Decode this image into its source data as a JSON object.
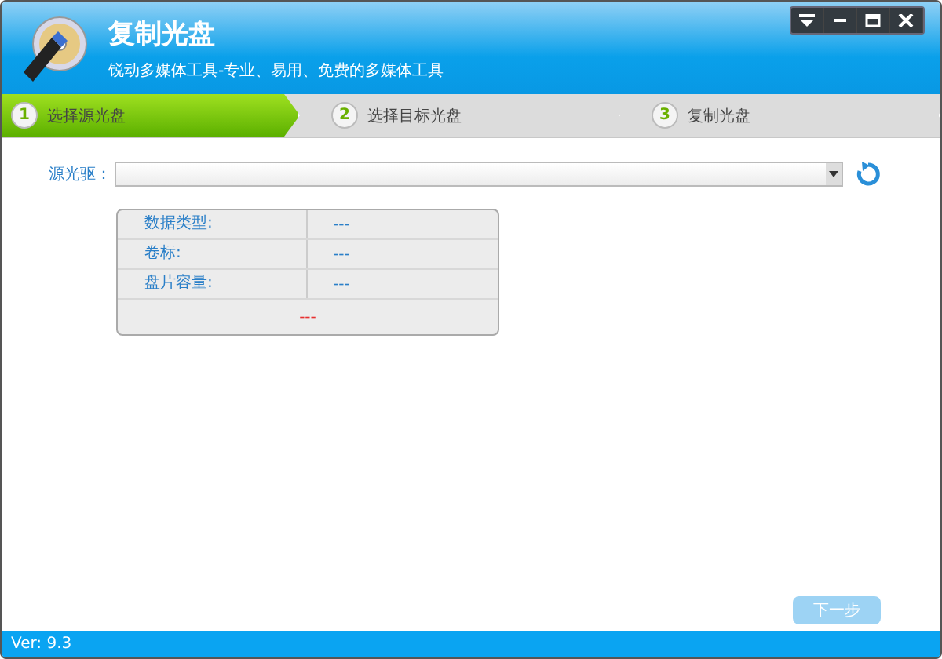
{
  "window": {
    "title": "复制光盘",
    "subtitle": "锐动多媒体工具-专业、易用、免费的多媒体工具"
  },
  "steps": [
    {
      "number": "1",
      "label": "选择源光盘",
      "selected": true
    },
    {
      "number": "2",
      "label": "选择目标光盘",
      "selected": false
    },
    {
      "number": "3",
      "label": "复制光盘",
      "selected": false
    }
  ],
  "source": {
    "label": "源光驱："
  },
  "info": {
    "rows": [
      {
        "label": "数据类型:",
        "value": "---"
      },
      {
        "label": "卷标:",
        "value": "---"
      },
      {
        "label": "盘片容量:",
        "value": "---"
      }
    ],
    "status": "---"
  },
  "next_button": {
    "label": "下一步",
    "disabled": true
  },
  "status_bar": {
    "version": "Ver: 9.3"
  }
}
